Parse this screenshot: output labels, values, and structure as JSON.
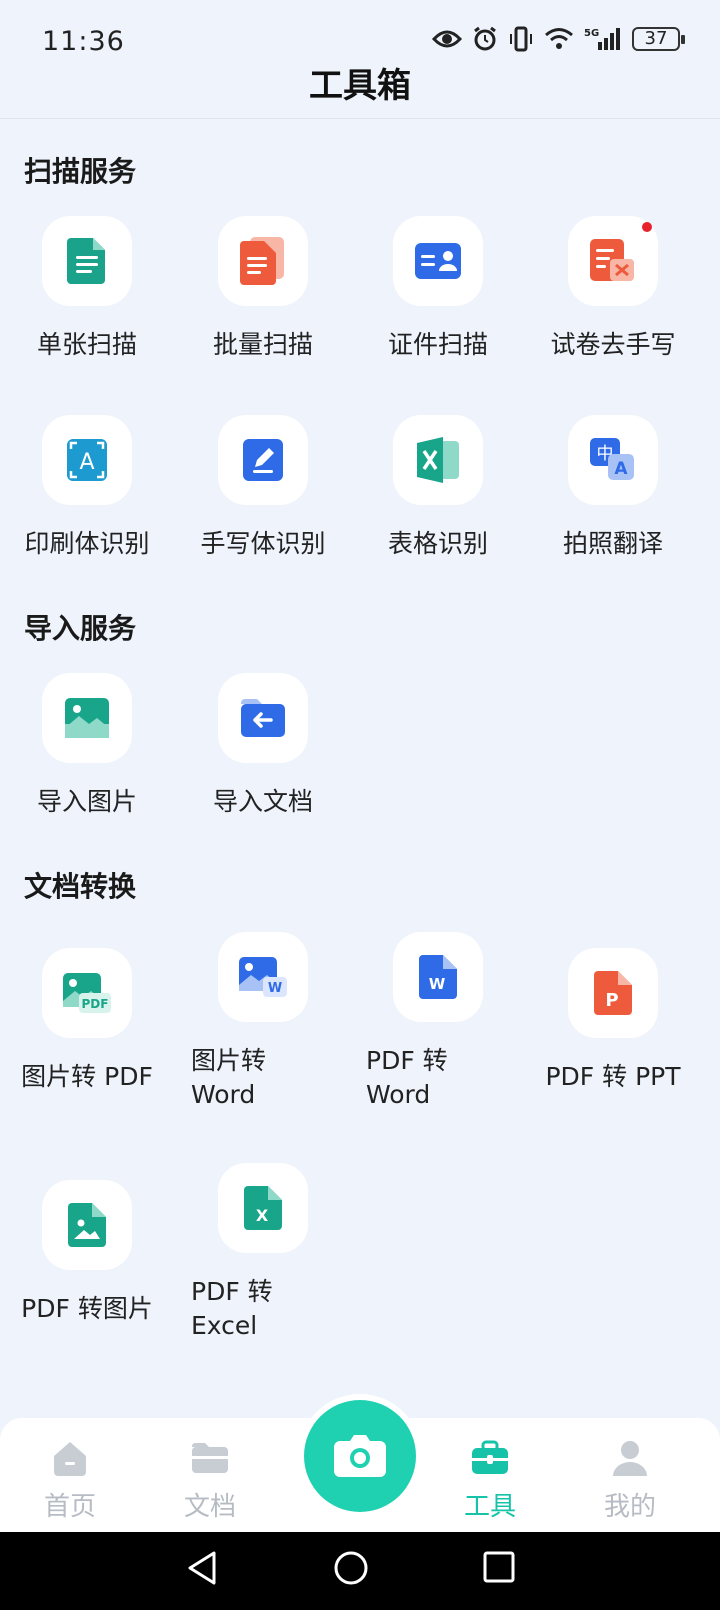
{
  "status_bar": {
    "time": "11:36",
    "battery": "37",
    "network": "5G"
  },
  "header": {
    "title": "工具箱"
  },
  "sections": [
    {
      "title": "扫描服务",
      "tools": [
        {
          "label": "单张扫描",
          "icon": "single-doc-icon",
          "color": "#1aa38a"
        },
        {
          "label": "批量扫描",
          "icon": "batch-doc-icon",
          "color": "#ee5a3c"
        },
        {
          "label": "证件扫描",
          "icon": "id-card-icon",
          "color": "#2f6be6"
        },
        {
          "label": "试卷去手写",
          "icon": "erase-handwriting-icon",
          "color": "#ee5a3c",
          "badge": true
        }
      ]
    },
    {
      "title": "",
      "tools": [
        {
          "label": "印刷体识别",
          "icon": "text-recognition-icon",
          "color": "#1d9bd1"
        },
        {
          "label": "手写体识别",
          "icon": "handwriting-icon",
          "color": "#2f6be6"
        },
        {
          "label": "表格识别",
          "icon": "excel-icon",
          "color": "#18a589"
        },
        {
          "label": "拍照翻译",
          "icon": "translate-icon",
          "color": "#2f6be6"
        }
      ]
    },
    {
      "title": "导入服务",
      "tools": [
        {
          "label": "导入图片",
          "icon": "image-import-icon",
          "color": "#18a589"
        },
        {
          "label": "导入文档",
          "icon": "folder-import-icon",
          "color": "#2f6be6"
        }
      ]
    },
    {
      "title": "文档转换",
      "tools": [
        {
          "label": "图片转 PDF",
          "icon": "image-to-pdf-icon",
          "color": "#18a589"
        },
        {
          "label": "图片转 Word",
          "icon": "image-to-word-icon",
          "color": "#2f6be6"
        },
        {
          "label": "PDF 转 Word",
          "icon": "word-file-icon",
          "color": "#2f6be6"
        },
        {
          "label": "PDF 转 PPT",
          "icon": "ppt-file-icon",
          "color": "#ee5a3c"
        }
      ]
    },
    {
      "title": "",
      "tools": [
        {
          "label": "PDF 转图片",
          "icon": "pdf-to-image-icon",
          "color": "#18a589"
        },
        {
          "label": "PDF 转 Excel",
          "icon": "excel-file-icon",
          "color": "#18a589"
        }
      ]
    }
  ],
  "section_titles": {
    "scan": "扫描服务",
    "import": "导入服务",
    "convert": "文档转换"
  },
  "labels": {
    "t1": "单张扫描",
    "t2": "批量扫描",
    "t3": "证件扫描",
    "t4": "试卷去手写",
    "t5": "印刷体识别",
    "t6": "手写体识别",
    "t7": "表格识别",
    "t8": "拍照翻译",
    "t9": "导入图片",
    "t10": "导入文档",
    "t11": "图片转 PDF",
    "t12a": "图片转",
    "t12b": "Word",
    "t13a": "PDF 转",
    "t13b": "Word",
    "t14": "PDF 转 PPT",
    "t15": "PDF 转图片",
    "t16a": "PDF 转",
    "t16b": "Excel"
  },
  "bottom_nav": {
    "items": [
      {
        "label": "首页",
        "icon": "home-icon"
      },
      {
        "label": "文档",
        "icon": "folder-icon"
      },
      {
        "label": "工具",
        "icon": "toolbox-icon",
        "active": true
      },
      {
        "label": "我的",
        "icon": "user-icon"
      }
    ],
    "accent": "#17c3a8",
    "camera_color": "#1fd1b1"
  }
}
